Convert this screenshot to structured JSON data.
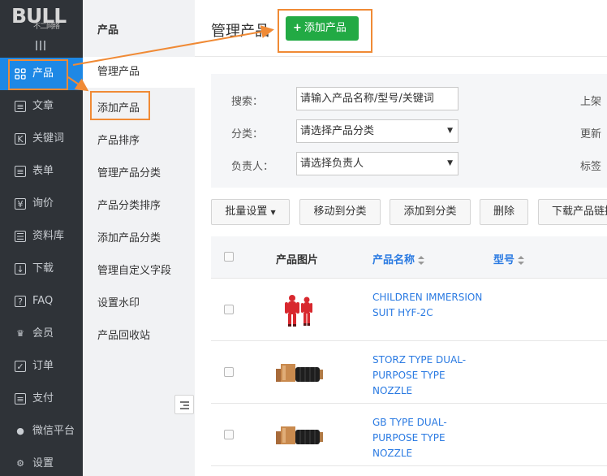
{
  "logo": {
    "main": "BULL",
    "sub": "不二网络"
  },
  "sidebar": {
    "items": [
      {
        "label": "产品",
        "icon": "grid-icon",
        "active": true
      },
      {
        "label": "文章",
        "icon": "article-icon"
      },
      {
        "label": "关键词",
        "icon": "keyword-icon"
      },
      {
        "label": "表单",
        "icon": "form-icon"
      },
      {
        "label": "询价",
        "icon": "inquiry-icon"
      },
      {
        "label": "资料库",
        "icon": "database-icon"
      },
      {
        "label": "下载",
        "icon": "download-icon"
      },
      {
        "label": "FAQ",
        "icon": "faq-icon"
      },
      {
        "label": "会员",
        "icon": "crown-icon"
      },
      {
        "label": "订单",
        "icon": "order-icon"
      },
      {
        "label": "支付",
        "icon": "payment-icon"
      },
      {
        "label": "微信平台",
        "icon": "wechat-icon"
      },
      {
        "label": "设置",
        "icon": "gear-icon"
      }
    ]
  },
  "submenu": {
    "title": "产品",
    "items": [
      {
        "label": "管理产品",
        "current": true
      },
      {
        "label": "添加产品"
      },
      {
        "label": "产品排序"
      },
      {
        "label": "管理产品分类"
      },
      {
        "label": "产品分类排序"
      },
      {
        "label": "添加产品分类"
      },
      {
        "label": "管理自定义字段"
      },
      {
        "label": "设置水印"
      },
      {
        "label": "产品回收站"
      }
    ]
  },
  "header": {
    "title": "管理产品",
    "add_button": "添加产品",
    "add_icon": "+"
  },
  "filter": {
    "search_label": "搜索：",
    "search_placeholder": "请输入产品名称/型号/关键词",
    "category_label": "分类：",
    "category_value": "请选择产品分类",
    "owner_label": "负责人：",
    "owner_value": "请选择负责人",
    "right_1": "上架",
    "right_2": "更新",
    "right_3": "标签"
  },
  "actions": {
    "batch": "批量设置",
    "move": "移动到分类",
    "add_to": "添加到分类",
    "delete": "删除",
    "download": "下载产品链接"
  },
  "table": {
    "headers": {
      "image": "产品图片",
      "name": "产品名称",
      "model": "型号"
    },
    "rows": [
      {
        "name": "CHILDREN IMMERSION SUIT HYF-2C",
        "image": "immersion-suit"
      },
      {
        "name": "STORZ TYPE DUAL-PURPOSE TYPE NOZZLE",
        "image": "nozzle"
      },
      {
        "name": "GB TYPE DUAL-PURPOSE TYPE NOZZLE",
        "image": "nozzle"
      }
    ]
  },
  "colors": {
    "sidebar_bg": "#2f3338",
    "active_blue": "#1e88e5",
    "add_green": "#22aa44",
    "annotation_orange": "#f08a35",
    "link_blue": "#2a7ae2"
  }
}
